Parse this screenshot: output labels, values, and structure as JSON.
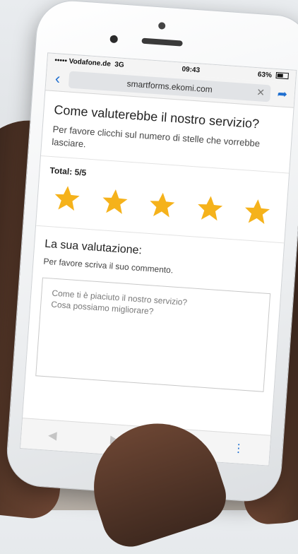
{
  "status_bar": {
    "carrier": "••••• Vodafone.de",
    "network": "3G",
    "time": "09:43",
    "battery_percent": "63%",
    "battery_level": 0.63
  },
  "browser": {
    "url": "smartforms.ekomi.com"
  },
  "question": {
    "title": "Come valuterebbe il nostro servizio?",
    "subtitle": "Per favore clicchi sul numero di stelle che vorrebbe lasciare."
  },
  "rating": {
    "total_label": "Total: 5/5",
    "value": 5,
    "max": 5,
    "star_color": "#f5b21b"
  },
  "review": {
    "title": "La sua valutazione:",
    "subtitle": "Per favore scriva il suo commento.",
    "placeholder": "Come ti è piaciuto il nostro servizio?\nCosa possiamo migliorare?"
  },
  "colors": {
    "accent": "#1f6fd0"
  }
}
